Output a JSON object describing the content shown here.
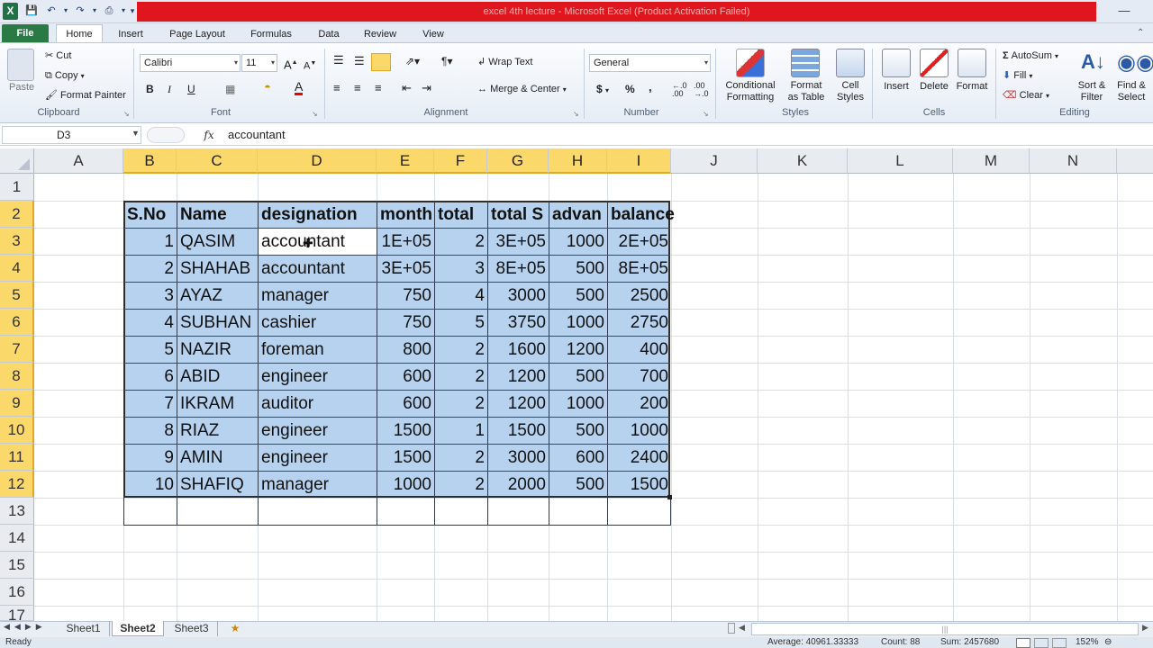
{
  "window": {
    "title": "excel 4th lecture - Microsoft Excel (Product Activation Failed)"
  },
  "tabs": [
    "File",
    "Home",
    "Insert",
    "Page Layout",
    "Formulas",
    "Data",
    "Review",
    "View"
  ],
  "ribbon": {
    "clipboard": {
      "paste": "Paste",
      "cut": "Cut",
      "copy": "Copy",
      "format_painter": "Format Painter",
      "label": "Clipboard"
    },
    "font": {
      "name": "Calibri",
      "size": "11",
      "label": "Font"
    },
    "alignment": {
      "wrap": "Wrap Text",
      "merge": "Merge & Center",
      "label": "Alignment"
    },
    "number": {
      "format": "General",
      "currency": "$",
      "percent": "%",
      "comma": ",",
      "label": "Number"
    },
    "styles": {
      "conditional": "Conditional\nFormatting",
      "format_table": "Format\nas Table",
      "cell_styles": "Cell\nStyles",
      "label": "Styles"
    },
    "cells": {
      "insert": "Insert",
      "delete": "Delete",
      "format": "Format",
      "label": "Cells"
    },
    "editing": {
      "autosum": "AutoSum",
      "fill": "Fill",
      "clear": "Clear",
      "sort": "Sort &\nFilter",
      "find": "Find &\nSelect",
      "label": "Editing"
    }
  },
  "formula_bar": {
    "name_box": "D3",
    "fx": "fx",
    "content": "accountant"
  },
  "columns": [
    "A",
    "B",
    "C",
    "D",
    "E",
    "F",
    "G",
    "H",
    "I",
    "J",
    "K",
    "L",
    "M",
    "N"
  ],
  "rows": [
    "1",
    "2",
    "3",
    "4",
    "5",
    "6",
    "7",
    "8",
    "9",
    "10",
    "11",
    "12",
    "13",
    "14",
    "15",
    "16",
    "17"
  ],
  "table": {
    "headers": [
      "S.No",
      "Name",
      "designation",
      "month",
      "total",
      "total S",
      "advan",
      "balance"
    ],
    "data": [
      [
        "1",
        "QASIM",
        "accountant",
        "1E+05",
        "2",
        "3E+05",
        "1000",
        "2E+05"
      ],
      [
        "2",
        "SHAHAB",
        "accountant",
        "3E+05",
        "3",
        "8E+05",
        "500",
        "8E+05"
      ],
      [
        "3",
        "AYAZ",
        "manager",
        "750",
        "4",
        "3000",
        "500",
        "2500"
      ],
      [
        "4",
        "SUBHAN",
        "cashier",
        "750",
        "5",
        "3750",
        "1000",
        "2750"
      ],
      [
        "5",
        "NAZIR",
        "foreman",
        "800",
        "2",
        "1600",
        "1200",
        "400"
      ],
      [
        "6",
        "ABID",
        "engineer",
        "600",
        "2",
        "1200",
        "500",
        "700"
      ],
      [
        "7",
        "IKRAM",
        "auditor",
        "600",
        "2",
        "1200",
        "1000",
        "200"
      ],
      [
        "8",
        "RIAZ",
        "engineer",
        "1500",
        "1",
        "1500",
        "500",
        "1000"
      ],
      [
        "9",
        "AMIN",
        "engineer",
        "1500",
        "2",
        "3000",
        "600",
        "2400"
      ],
      [
        "10",
        "SHAFIQ",
        "manager",
        "1000",
        "2",
        "2000",
        "500",
        "1500"
      ]
    ]
  },
  "sheets": [
    "Sheet1",
    "Sheet2",
    "Sheet3"
  ],
  "active_sheet": "Sheet2",
  "status": {
    "mode": "Ready",
    "average": "Average: 40961.33333",
    "count": "Count: 88",
    "sum": "Sum: 2457680",
    "zoom": "152%"
  }
}
